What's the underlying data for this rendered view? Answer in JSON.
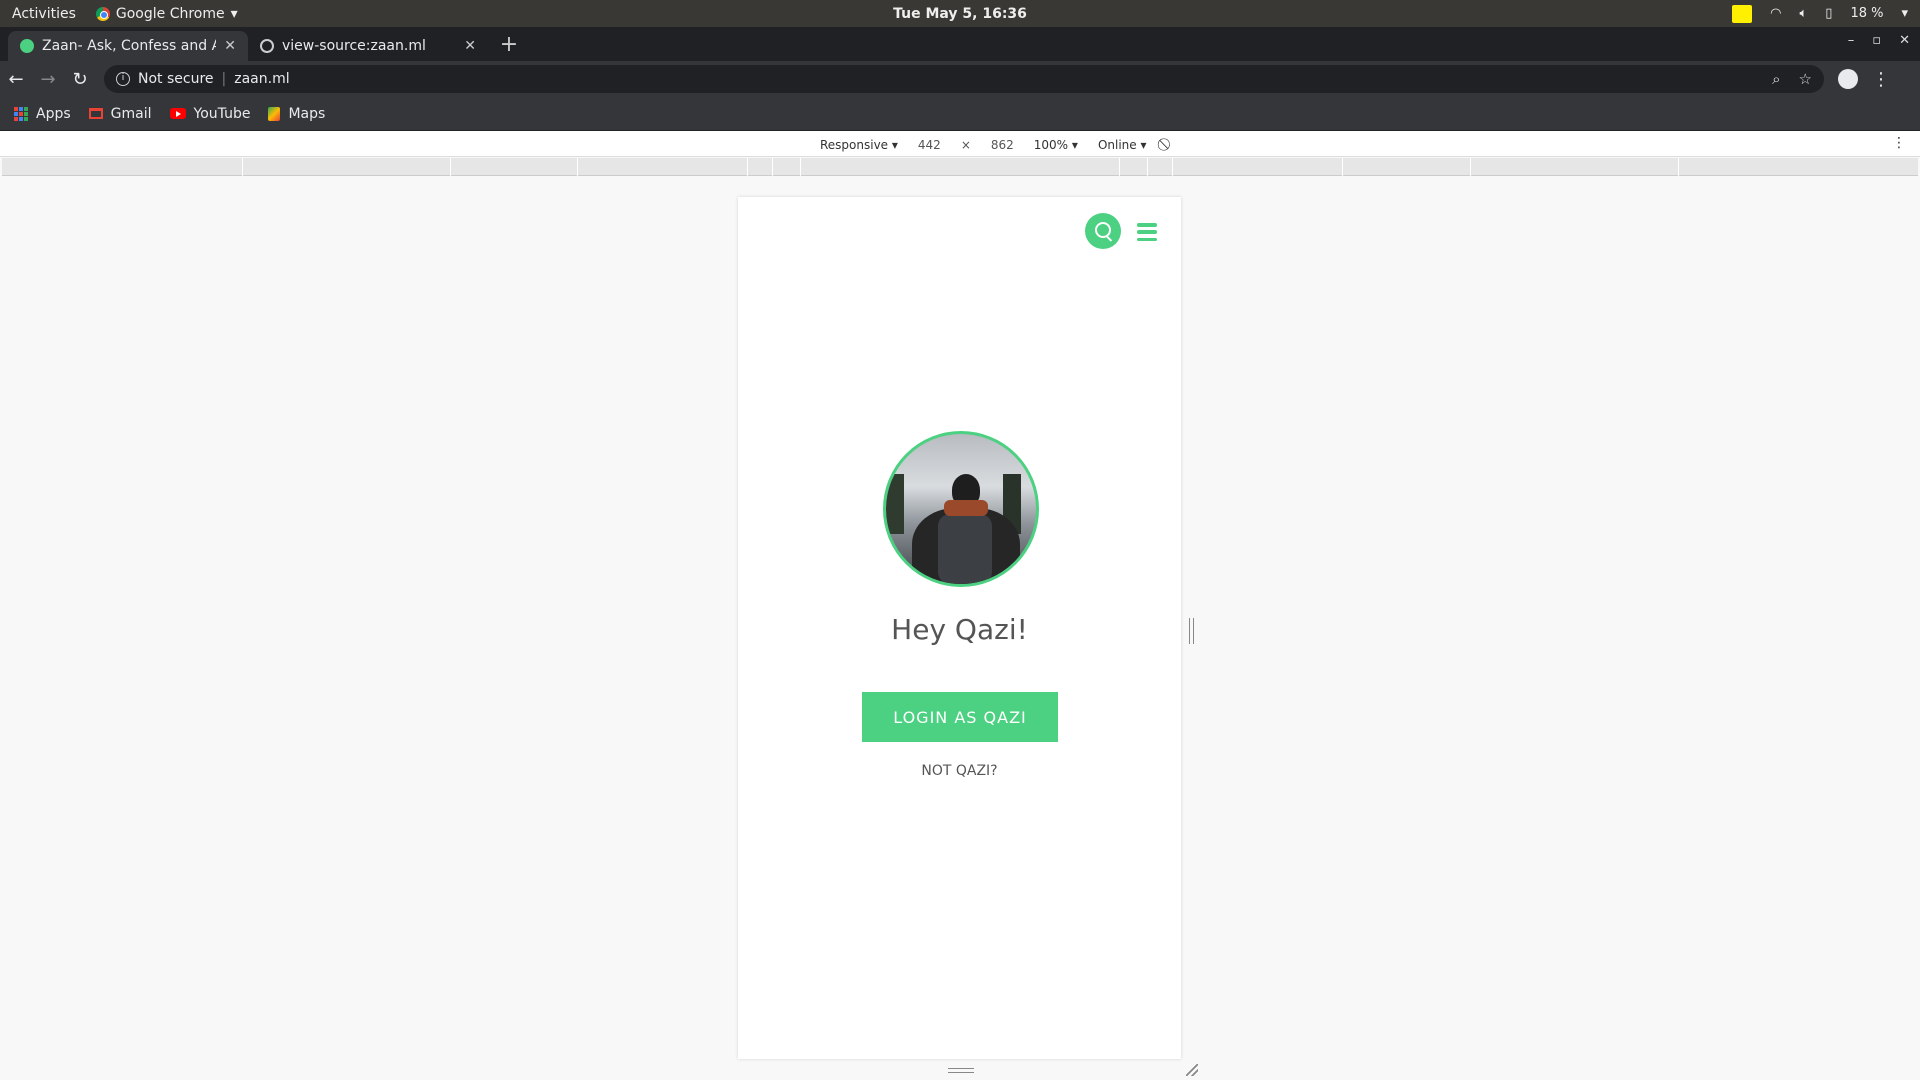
{
  "system": {
    "activities": "Activities",
    "app_name": "Google Chrome",
    "clock": "Tue May  5, 16:36",
    "battery": "18 %"
  },
  "tabs": [
    {
      "title": "Zaan- Ask, Confess and Ar",
      "active": true
    },
    {
      "title": "view-source:zaan.ml",
      "active": false
    }
  ],
  "address": {
    "security": "Not secure",
    "url": "zaan.ml"
  },
  "bookmarks": [
    {
      "label": "Apps",
      "icon": "apps-icon"
    },
    {
      "label": "Gmail",
      "icon": "gmail-icon"
    },
    {
      "label": "YouTube",
      "icon": "youtube-icon"
    },
    {
      "label": "Maps",
      "icon": "maps-icon"
    }
  ],
  "device_toolbar": {
    "mode": "Responsive ▾",
    "width": "442",
    "times": "×",
    "height": "862",
    "zoom": "100% ▾",
    "network": "Online ▾"
  },
  "page": {
    "greeting": "Hey Qazi!",
    "login_button": "LOGIN AS QAZI",
    "not_user": "NOT QAZI?",
    "accent_color": "#4cd081"
  }
}
